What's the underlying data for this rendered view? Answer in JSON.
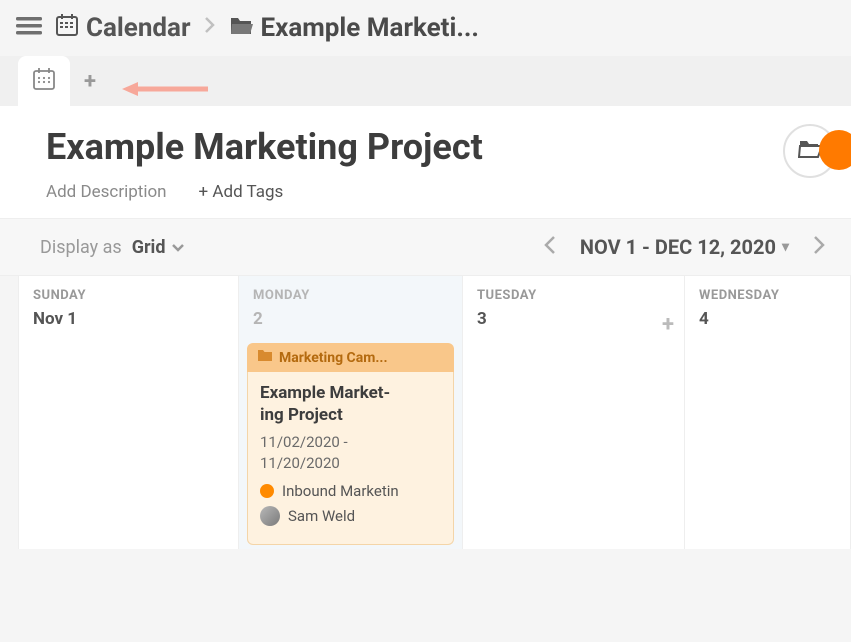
{
  "header": {
    "breadcrumb_calendar": "Calendar",
    "breadcrumb_folder": "Example Marketi..."
  },
  "project": {
    "title": "Example Marketing Project",
    "add_description": "Add Description",
    "add_tags": "+ Add Tags"
  },
  "controls": {
    "display_label": "Display as",
    "display_value": "Grid",
    "date_range": "NOV 1 - DEC 12, 2020"
  },
  "days": {
    "sunday": {
      "label": "SUNDAY",
      "date": "Nov 1"
    },
    "monday": {
      "label": "MONDAY",
      "date": "2"
    },
    "tuesday": {
      "label": "TUESDAY",
      "date": "3"
    },
    "wednesday": {
      "label": "WEDNESDAY",
      "date": "4"
    }
  },
  "event": {
    "tag": "Marketing Cam...",
    "title": "Example Market-\ning Project",
    "title_line1": "Example Market-",
    "title_line2": "ing Project",
    "date_start": "11/02/2020 -",
    "date_end": "11/20/2020",
    "category": "Inbound Marketin",
    "assignee": "Sam Weld"
  },
  "icons": {
    "plus": "+",
    "dropdown_glyph": "▾"
  }
}
